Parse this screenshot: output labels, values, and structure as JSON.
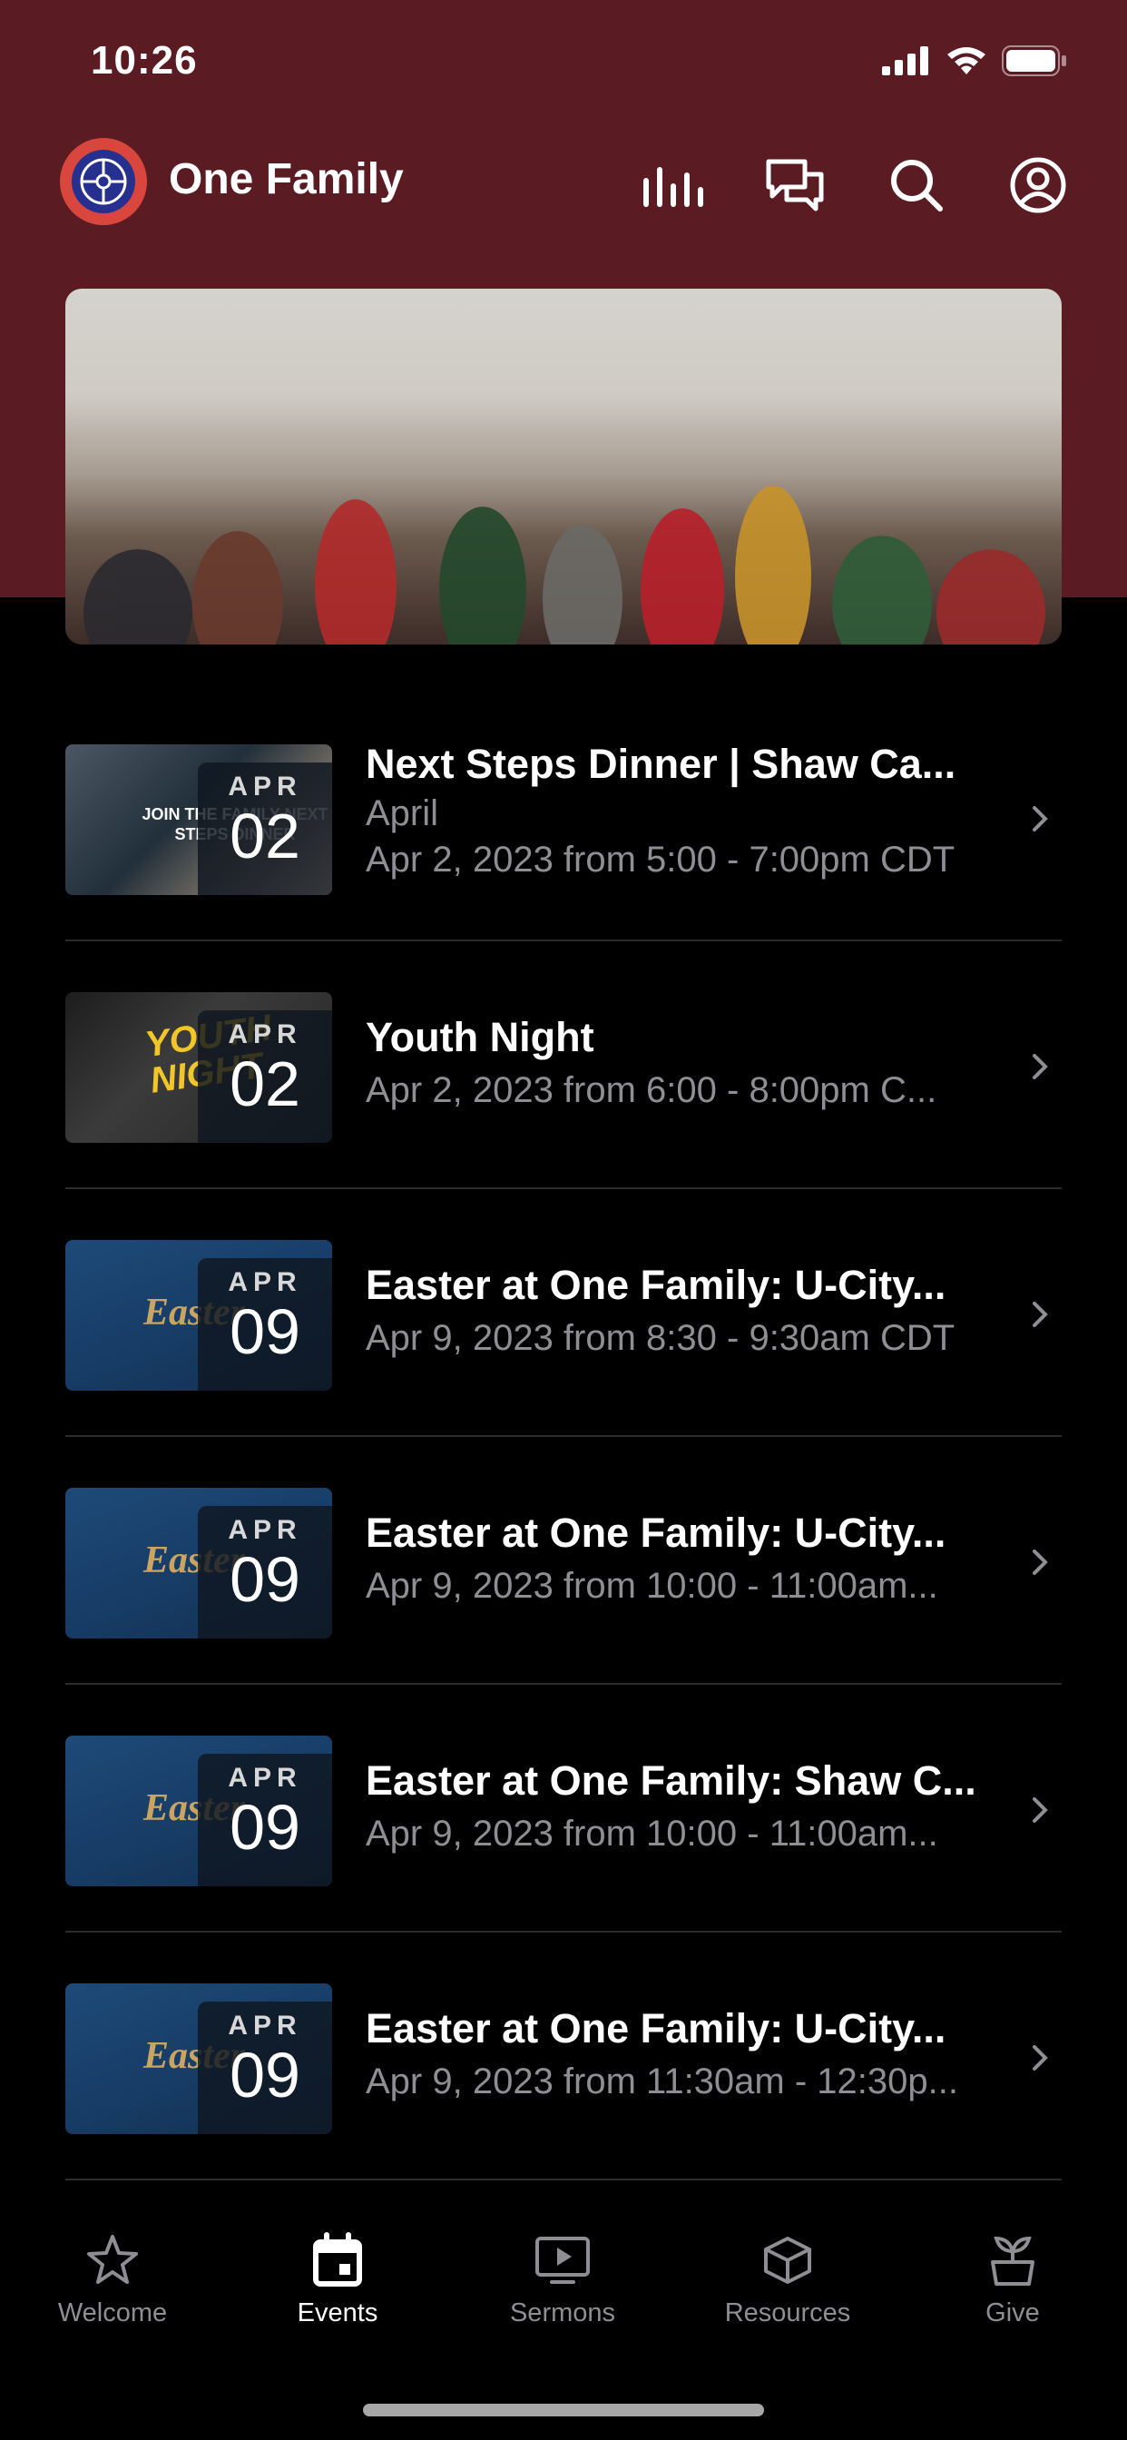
{
  "status_bar": {
    "time": "10:26"
  },
  "header": {
    "title": "One Family",
    "icons": [
      "audio-bars-icon",
      "chat-icon",
      "search-icon",
      "profile-icon"
    ]
  },
  "colors": {
    "brand": "#5a1b22",
    "logo_outer": "#d9463d",
    "logo_inner": "#26308f"
  },
  "events": [
    {
      "title": "Next Steps Dinner | Shaw Ca...",
      "subtitle": "April",
      "time": "Apr 2, 2023 from 5:00 - 7:00pm CDT",
      "month": "APR",
      "day": "02",
      "thumb_text": "JOIN THE FAMILY NEXT STEPS DINNER"
    },
    {
      "title": "Youth Night",
      "time": "Apr 2, 2023 from 6:00 - 8:00pm C...",
      "month": "APR",
      "day": "02",
      "thumb_text": "YOUTH NIGHT"
    },
    {
      "title": "Easter at One Family: U-City...",
      "time": "Apr 9, 2023 from 8:30 - 9:30am CDT",
      "month": "APR",
      "day": "09",
      "thumb_text": "Easter"
    },
    {
      "title": "Easter at One Family: U-City...",
      "time": "Apr 9, 2023 from 10:00 - 11:00am...",
      "month": "APR",
      "day": "09",
      "thumb_text": "Easter"
    },
    {
      "title": "Easter at One Family: Shaw C...",
      "time": "Apr 9, 2023 from 10:00 - 11:00am...",
      "month": "APR",
      "day": "09",
      "thumb_text": "Easter"
    },
    {
      "title": "Easter at One Family: U-City...",
      "time": "Apr 9, 2023 from 11:30am - 12:30p...",
      "month": "APR",
      "day": "09",
      "thumb_text": "Easter"
    }
  ],
  "tabs": [
    {
      "label": "Welcome",
      "icon": "star-icon",
      "active": false
    },
    {
      "label": "Events",
      "icon": "calendar-icon",
      "active": true
    },
    {
      "label": "Sermons",
      "icon": "video-icon",
      "active": false
    },
    {
      "label": "Resources",
      "icon": "box-icon",
      "active": false
    },
    {
      "label": "Give",
      "icon": "plant-icon",
      "active": false
    }
  ]
}
